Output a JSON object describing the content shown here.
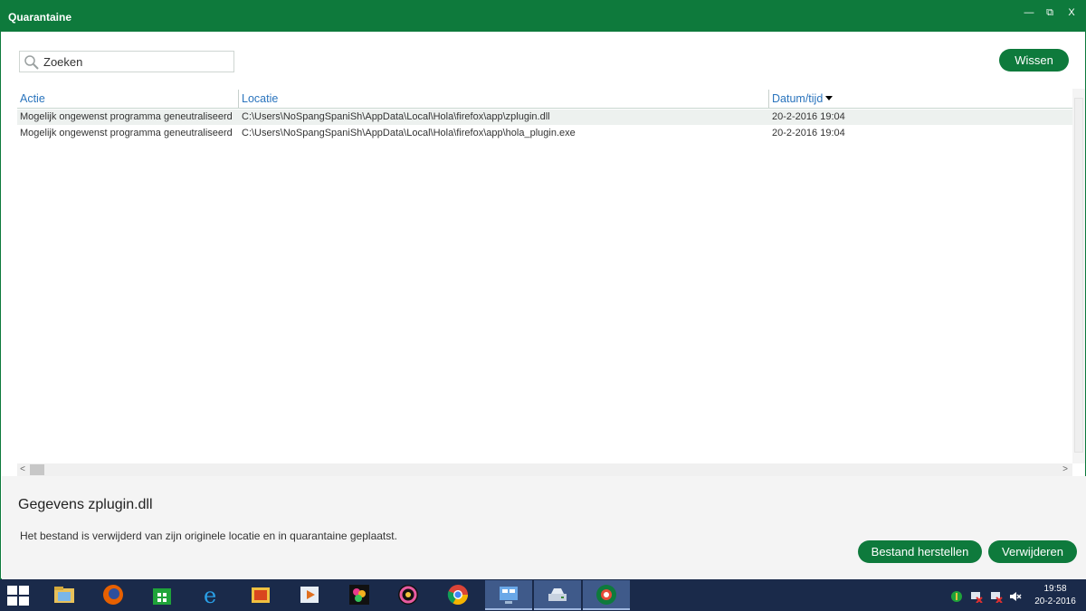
{
  "window": {
    "title": "Quarantaine",
    "controls": {
      "minimize": "—",
      "restore": "⧉",
      "close": "X"
    }
  },
  "search": {
    "placeholder": "Zoeken",
    "value": ""
  },
  "toolbar": {
    "clear_label": "Wissen"
  },
  "table": {
    "columns": [
      "Actie",
      "Locatie",
      "Datum/tijd"
    ],
    "sort_column": "Datum/tijd",
    "rows": [
      {
        "actie": "Mogelijk ongewenst programma geneutraliseerd",
        "locatie": "C:\\Users\\NoSpangSpaniSh\\AppData\\Local\\Hola\\firefox\\app\\zplugin.dll",
        "datum": "20-2-2016 19:04",
        "selected": true
      },
      {
        "actie": "Mogelijk ongewenst programma geneutraliseerd",
        "locatie": "C:\\Users\\NoSpangSpaniSh\\AppData\\Local\\Hola\\firefox\\app\\hola_plugin.exe",
        "datum": "20-2-2016 19:04",
        "selected": false
      }
    ]
  },
  "detail": {
    "title": "Gegevens zplugin.dll",
    "description": "Het bestand is verwijderd van zijn originele locatie en in quarantaine geplaatst.",
    "restore_label": "Bestand herstellen",
    "delete_label": "Verwijderen"
  },
  "taskbar": {
    "apps": [
      "start-icon",
      "file-explorer-icon",
      "firefox-icon",
      "store-icon",
      "internet-explorer-icon",
      "app-icon",
      "media-player-icon",
      "photo-app-icon",
      "color-app-icon",
      "chrome-icon",
      "control-panel-icon",
      "drive-icon",
      "antivirus-icon"
    ],
    "clock": {
      "time": "19:58",
      "date": "20-2-2016"
    }
  },
  "colors": {
    "accent": "#0e7a3c",
    "link": "#2a74bd",
    "taskbar": "#1a2a4a"
  }
}
